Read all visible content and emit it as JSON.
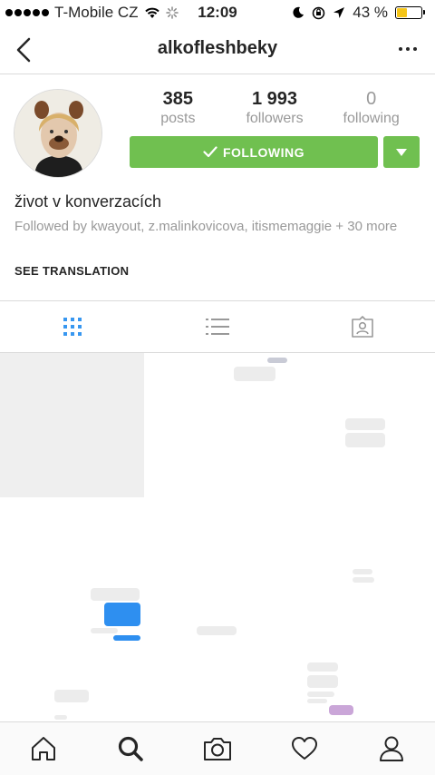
{
  "status_bar": {
    "carrier": "T-Mobile CZ",
    "time": "12:09",
    "battery": "43 %",
    "battery_level": 0.43,
    "accent_color": "#f5c518"
  },
  "header": {
    "username": "alkofleshbeky",
    "back_icon": "chevron-left-icon",
    "more_icon": "more-horizontal-icon"
  },
  "profile": {
    "stats": [
      {
        "value": "385",
        "label": "posts"
      },
      {
        "value": "1 993",
        "label": "followers"
      },
      {
        "value": "0",
        "label": "following"
      }
    ],
    "follow_button_label": "FOLLOWING",
    "button_color": "#70c050",
    "bio_name": "život v konverzacích",
    "followed_by": "Followed by kwayout, z.malinkovicova, itismemaggie + 30 more",
    "see_translation": "SEE TRANSLATION"
  },
  "tabs": [
    {
      "name": "grid-view-icon",
      "active": true
    },
    {
      "name": "list-view-icon",
      "active": false
    },
    {
      "name": "tagged-photos-icon",
      "active": false
    }
  ],
  "bottom_nav": [
    {
      "name": "home-icon"
    },
    {
      "name": "search-icon",
      "active": true
    },
    {
      "name": "camera-icon"
    },
    {
      "name": "heart-icon"
    },
    {
      "name": "profile-icon"
    }
  ]
}
